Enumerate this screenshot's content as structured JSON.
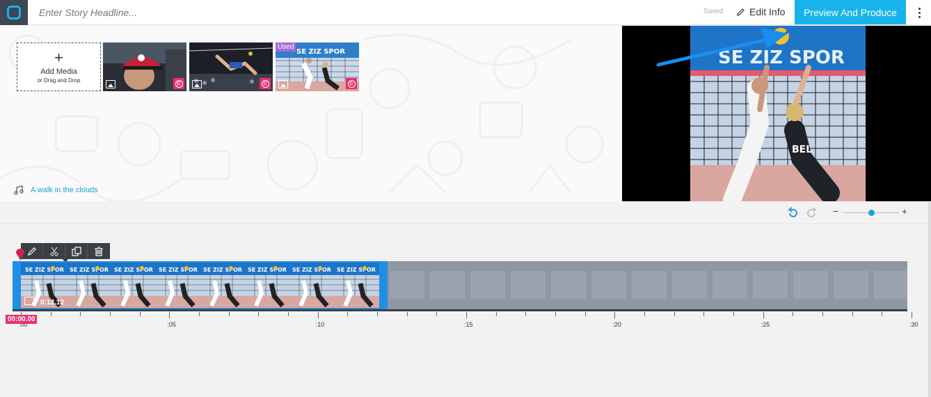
{
  "header": {
    "headline_placeholder": "Enter Story Headline...",
    "saved_label": "Saved",
    "edit_info_label": "Edit Info",
    "preview_button_label": "Preview And Produce"
  },
  "media": {
    "add_media_title": "Add Media",
    "add_media_subtitle": "or Drag and Drop",
    "add_media_symbol": "+",
    "items": [
      {
        "subject": "baseball player portrait",
        "used": false
      },
      {
        "subject": "volleyball action",
        "used": false
      },
      {
        "subject": "volleyball spike",
        "used": true,
        "badge": "Used"
      }
    ],
    "copy_symbol": "C"
  },
  "music": {
    "track_name": "A walk in the clouds"
  },
  "timeline": {
    "zoom_minus": "−",
    "zoom_plus": "+",
    "zoom_level": 0.5,
    "clip_duration": "0:12.12",
    "playhead_time": "00:00.00",
    "ticks": [
      ":00",
      ":05",
      ":10",
      ":15",
      ":20",
      ":25",
      ":30"
    ]
  },
  "colors": {
    "accent": "#19b3ec",
    "clip_selected": "#1f8fe6",
    "playhead": "#e8306e",
    "used_badge": "#a36bdb",
    "logo_bg": "#3d4652"
  }
}
